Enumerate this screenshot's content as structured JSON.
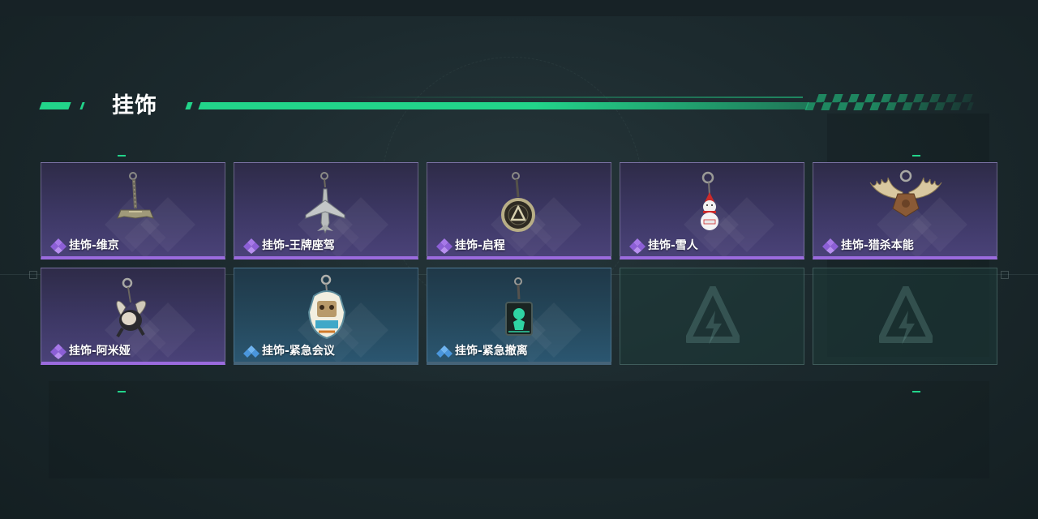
{
  "section": {
    "title": "挂饰"
  },
  "colors": {
    "accent": "#22d48a",
    "rarity_purple": "#9b6bde",
    "rarity_blue": "#4a9ee2"
  },
  "items": [
    {
      "label": "挂饰-维京",
      "rarity": "purple",
      "icon": "viking-hammer-charm-icon"
    },
    {
      "label": "挂饰-王牌座驾",
      "rarity": "purple",
      "icon": "jet-plane-charm-icon"
    },
    {
      "label": "挂饰-启程",
      "rarity": "purple",
      "icon": "ring-emblem-charm-icon"
    },
    {
      "label": "挂饰-雪人",
      "rarity": "purple",
      "icon": "snowman-charm-icon"
    },
    {
      "label": "挂饰-猎杀本能",
      "rarity": "purple",
      "icon": "moose-antlers-charm-icon"
    },
    {
      "label": "挂饰-阿米娅",
      "rarity": "purple",
      "icon": "amiya-charm-icon"
    },
    {
      "label": "挂饰-紧急会议",
      "rarity": "blue",
      "icon": "emergency-meeting-charm-icon"
    },
    {
      "label": "挂饰-紧急撤离",
      "rarity": "blue",
      "icon": "emergency-evac-charm-icon"
    }
  ],
  "empty_slots": [
    {
      "icon": "empty-slot-logo-icon"
    },
    {
      "icon": "empty-slot-logo-icon"
    }
  ]
}
